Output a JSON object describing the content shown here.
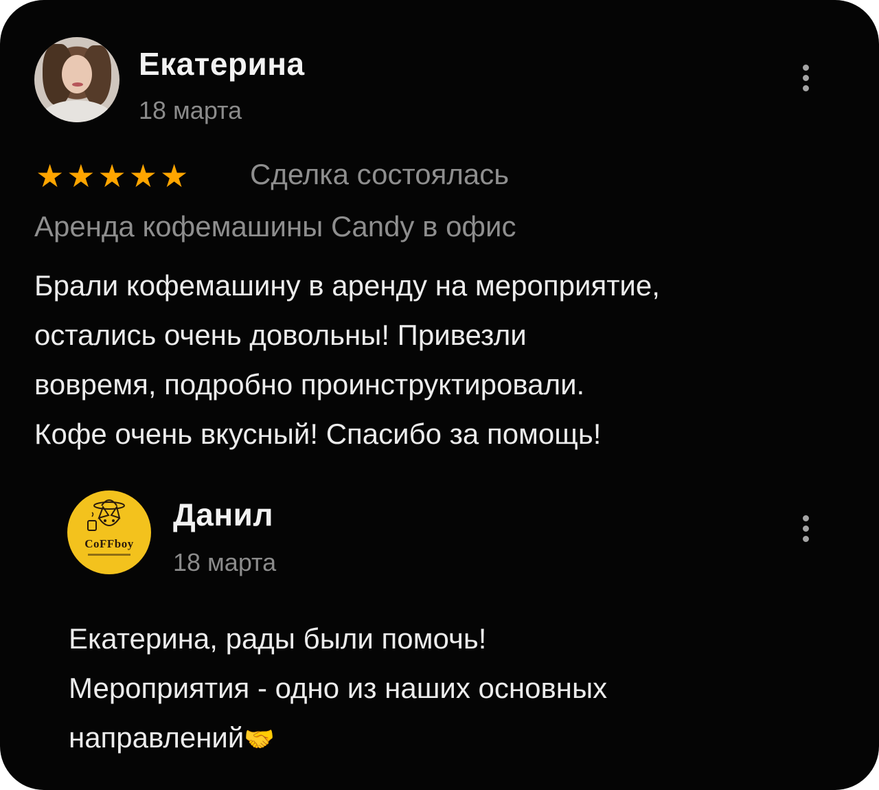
{
  "review": {
    "author": "Екатерина",
    "date": "18 марта",
    "rating": 5,
    "rating_max": 5,
    "star_glyph": "★",
    "star_color": "#ffa500",
    "deal_status": "Сделка состоялась",
    "service": "Аренда кофемашины Candy в офис",
    "text_lines": [
      "Брали кофемашину в аренду на мероприятие,",
      "остались очень довольны! Привезли",
      "вовремя, подробно проинструктировали.",
      "Кофе очень вкусный! Спасибо за помощь!"
    ],
    "menu_icon": "more-vertical-icon"
  },
  "reply": {
    "author": "Данил",
    "date": "18 марта",
    "avatar_logo_text": "CoFFboy",
    "avatar_color": "#f3c21d",
    "text_lines": [
      "Екатерина, рады были помочь!",
      "Мероприятия - одно из наших основных",
      "направлений"
    ],
    "emoji": "🤝",
    "menu_icon": "more-vertical-icon"
  },
  "colors": {
    "background": "#050505",
    "primary_text": "#ececec",
    "secondary_text": "#8e8e8e"
  }
}
